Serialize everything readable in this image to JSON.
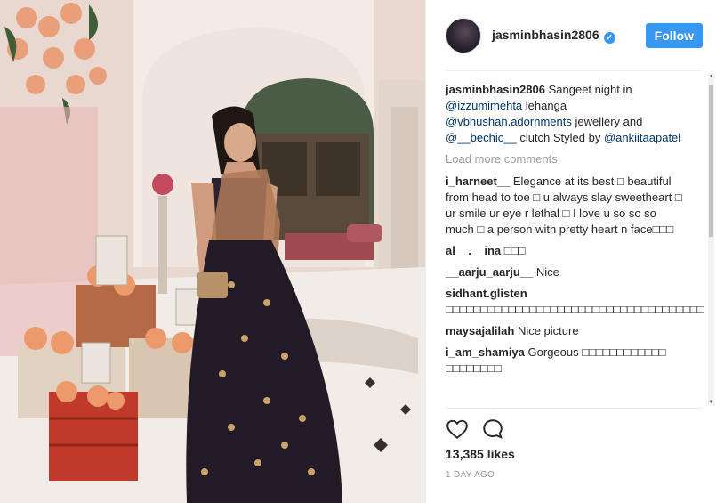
{
  "post": {
    "username": "jasminbhasin2806",
    "verified_badge": "✓",
    "follow_label": "Follow",
    "caption_user": "jasminbhasin2806",
    "caption": {
      "t1": " Sangeet night in ",
      "m1": "@izzumimehta",
      "t2": " lehanga ",
      "m2": "@vbhushan.adornments",
      "t3": " jewellery and ",
      "m3": "@__bechic__",
      "t4": " clutch Styled by ",
      "m4": "@ankiitaapatel"
    },
    "load_more": "Load more comments",
    "comments": [
      {
        "user": "i_harneet__",
        "text": " Elegance at its best □ beautiful from head to toe □ u always slay sweetheart □ ur smile ur eye r lethal □ I love u so so so much □ a person with pretty heart n face□□□"
      },
      {
        "user": "al__.__ina",
        "text": " □□□"
      },
      {
        "user": "__aarju_aarju__",
        "text": " Nice"
      },
      {
        "user": "sidhant.glisten",
        "text": " □□□□□□□□□□□□□□□□□□□□□□□□□□□□□□□□□□□□□"
      },
      {
        "user": "maysajalilah",
        "text": " Nice picture"
      },
      {
        "user": "i_am_shamiya",
        "text": " Gorgeous □□□□□□□□□□□□ □□□□□□□□"
      }
    ],
    "likes": "13,385 likes",
    "time_ago": "1 DAY AGO"
  },
  "icons": {
    "like": "heart-icon",
    "comment": "comment-icon",
    "verified": "verified-badge-icon"
  },
  "colors": {
    "accent": "#3897f0",
    "mention": "#003569",
    "muted": "#999999"
  }
}
